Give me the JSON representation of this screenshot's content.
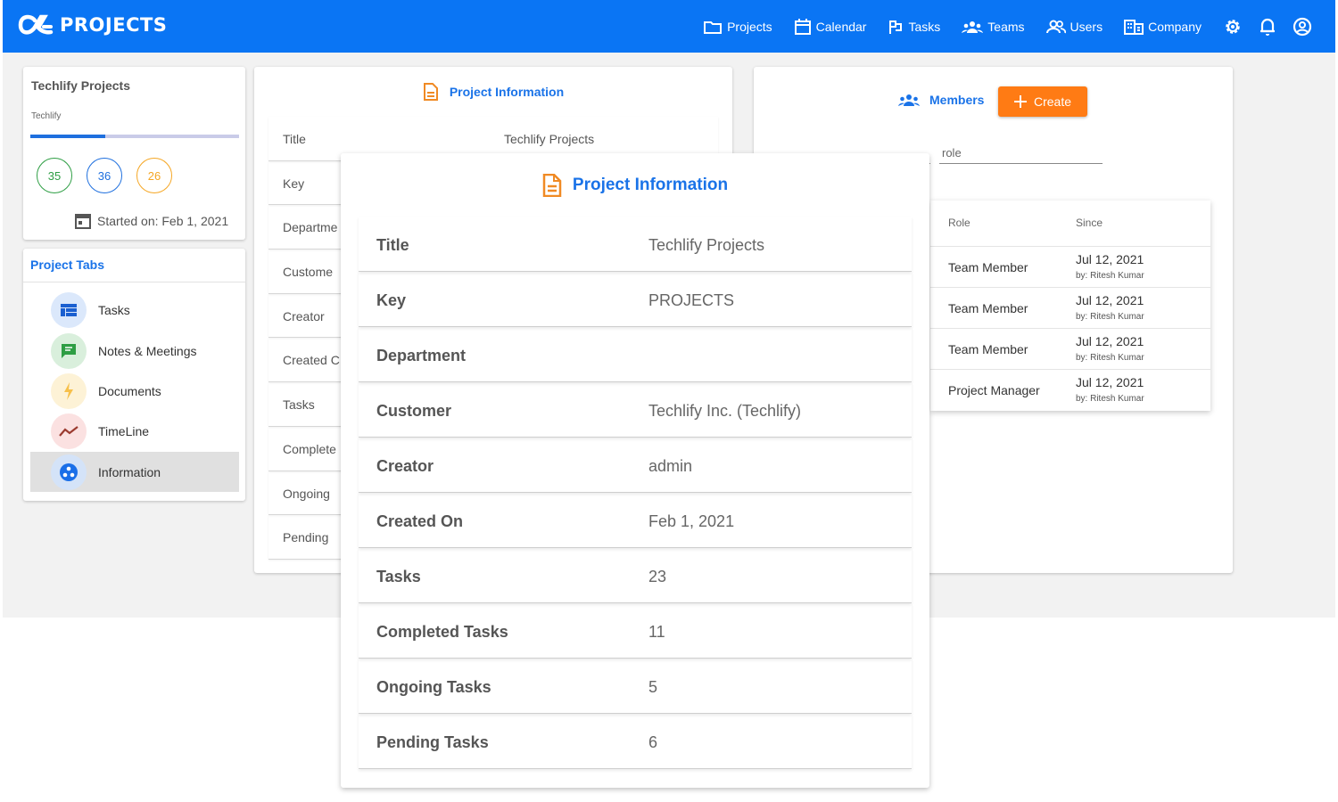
{
  "app": {
    "logo_text": "PROJECTS"
  },
  "nav": [
    {
      "label": "Projects",
      "icon": "folder-icon"
    },
    {
      "label": "Calendar",
      "icon": "calendar-icon"
    },
    {
      "label": "Tasks",
      "icon": "tasks-icon"
    },
    {
      "label": "Teams",
      "icon": "teams-icon"
    },
    {
      "label": "Users",
      "icon": "users-icon"
    },
    {
      "label": "Company",
      "icon": "company-icon"
    }
  ],
  "summary": {
    "title": "Techlify Projects",
    "subtitle": "Techlify",
    "progress_fraction": 0.36,
    "counts": [
      {
        "value": "35",
        "color": "#2e9e44"
      },
      {
        "value": "36",
        "color": "#1e6fde"
      },
      {
        "value": "26",
        "color": "#f5a623"
      }
    ],
    "started": "Started on: Feb 1, 2021"
  },
  "tabs": {
    "title": "Project Tabs",
    "items": [
      {
        "label": "Tasks",
        "icon": "board-icon"
      },
      {
        "label": "Notes & Meetings",
        "icon": "chat-icon"
      },
      {
        "label": "Documents",
        "icon": "bolt-icon"
      },
      {
        "label": "TimeLine",
        "icon": "trend-icon"
      },
      {
        "label": "Information",
        "icon": "info-icon"
      }
    ]
  },
  "info_back": {
    "heading": "Project Information",
    "rows": [
      {
        "key": "Title",
        "value": "Techlify Projects"
      },
      {
        "key": "Key",
        "value": ""
      },
      {
        "key": "Departme",
        "value": ""
      },
      {
        "key": "Custome",
        "value": ""
      },
      {
        "key": "Creator",
        "value": ""
      },
      {
        "key": "Created C",
        "value": ""
      },
      {
        "key": "Tasks",
        "value": ""
      },
      {
        "key": "Complete",
        "value": ""
      },
      {
        "key": "Ongoing",
        "value": ""
      },
      {
        "key": "Pending",
        "value": ""
      }
    ]
  },
  "members": {
    "heading": "Members",
    "create_label": "Create",
    "role_placeholder": "role",
    "columns": [
      "Role",
      "Since"
    ],
    "rows": [
      {
        "role": "Team Member",
        "date": "Jul 12, 2021",
        "by": "by: Ritesh Kumar"
      },
      {
        "role": "Team Member",
        "date": "Jul 12, 2021",
        "by": "by: Ritesh Kumar"
      },
      {
        "role": "Team Member",
        "date": "Jul 12, 2021",
        "by": "by: Ritesh Kumar"
      },
      {
        "role": "Project Manager",
        "date": "Jul 12, 2021",
        "by": "by: Ritesh Kumar"
      }
    ]
  },
  "info_front": {
    "heading": "Project Information",
    "rows": [
      {
        "key": "Title",
        "value": "Techlify Projects"
      },
      {
        "key": "Key",
        "value": "PROJECTS"
      },
      {
        "key": "Department",
        "value": ""
      },
      {
        "key": "Customer",
        "value": "Techlify Inc. (Techlify)"
      },
      {
        "key": "Creator",
        "value": "admin"
      },
      {
        "key": "Created On",
        "value": "Feb 1, 2021"
      },
      {
        "key": "Tasks",
        "value": "23"
      },
      {
        "key": "Completed Tasks",
        "value": "11"
      },
      {
        "key": "Ongoing Tasks",
        "value": "5"
      },
      {
        "key": "Pending Tasks",
        "value": "6"
      }
    ]
  },
  "colors": {
    "topbar": "#0a75f4",
    "accent": "#1a73e8",
    "create_button": "#ff7b14",
    "doc_icon": "#f08a24"
  }
}
